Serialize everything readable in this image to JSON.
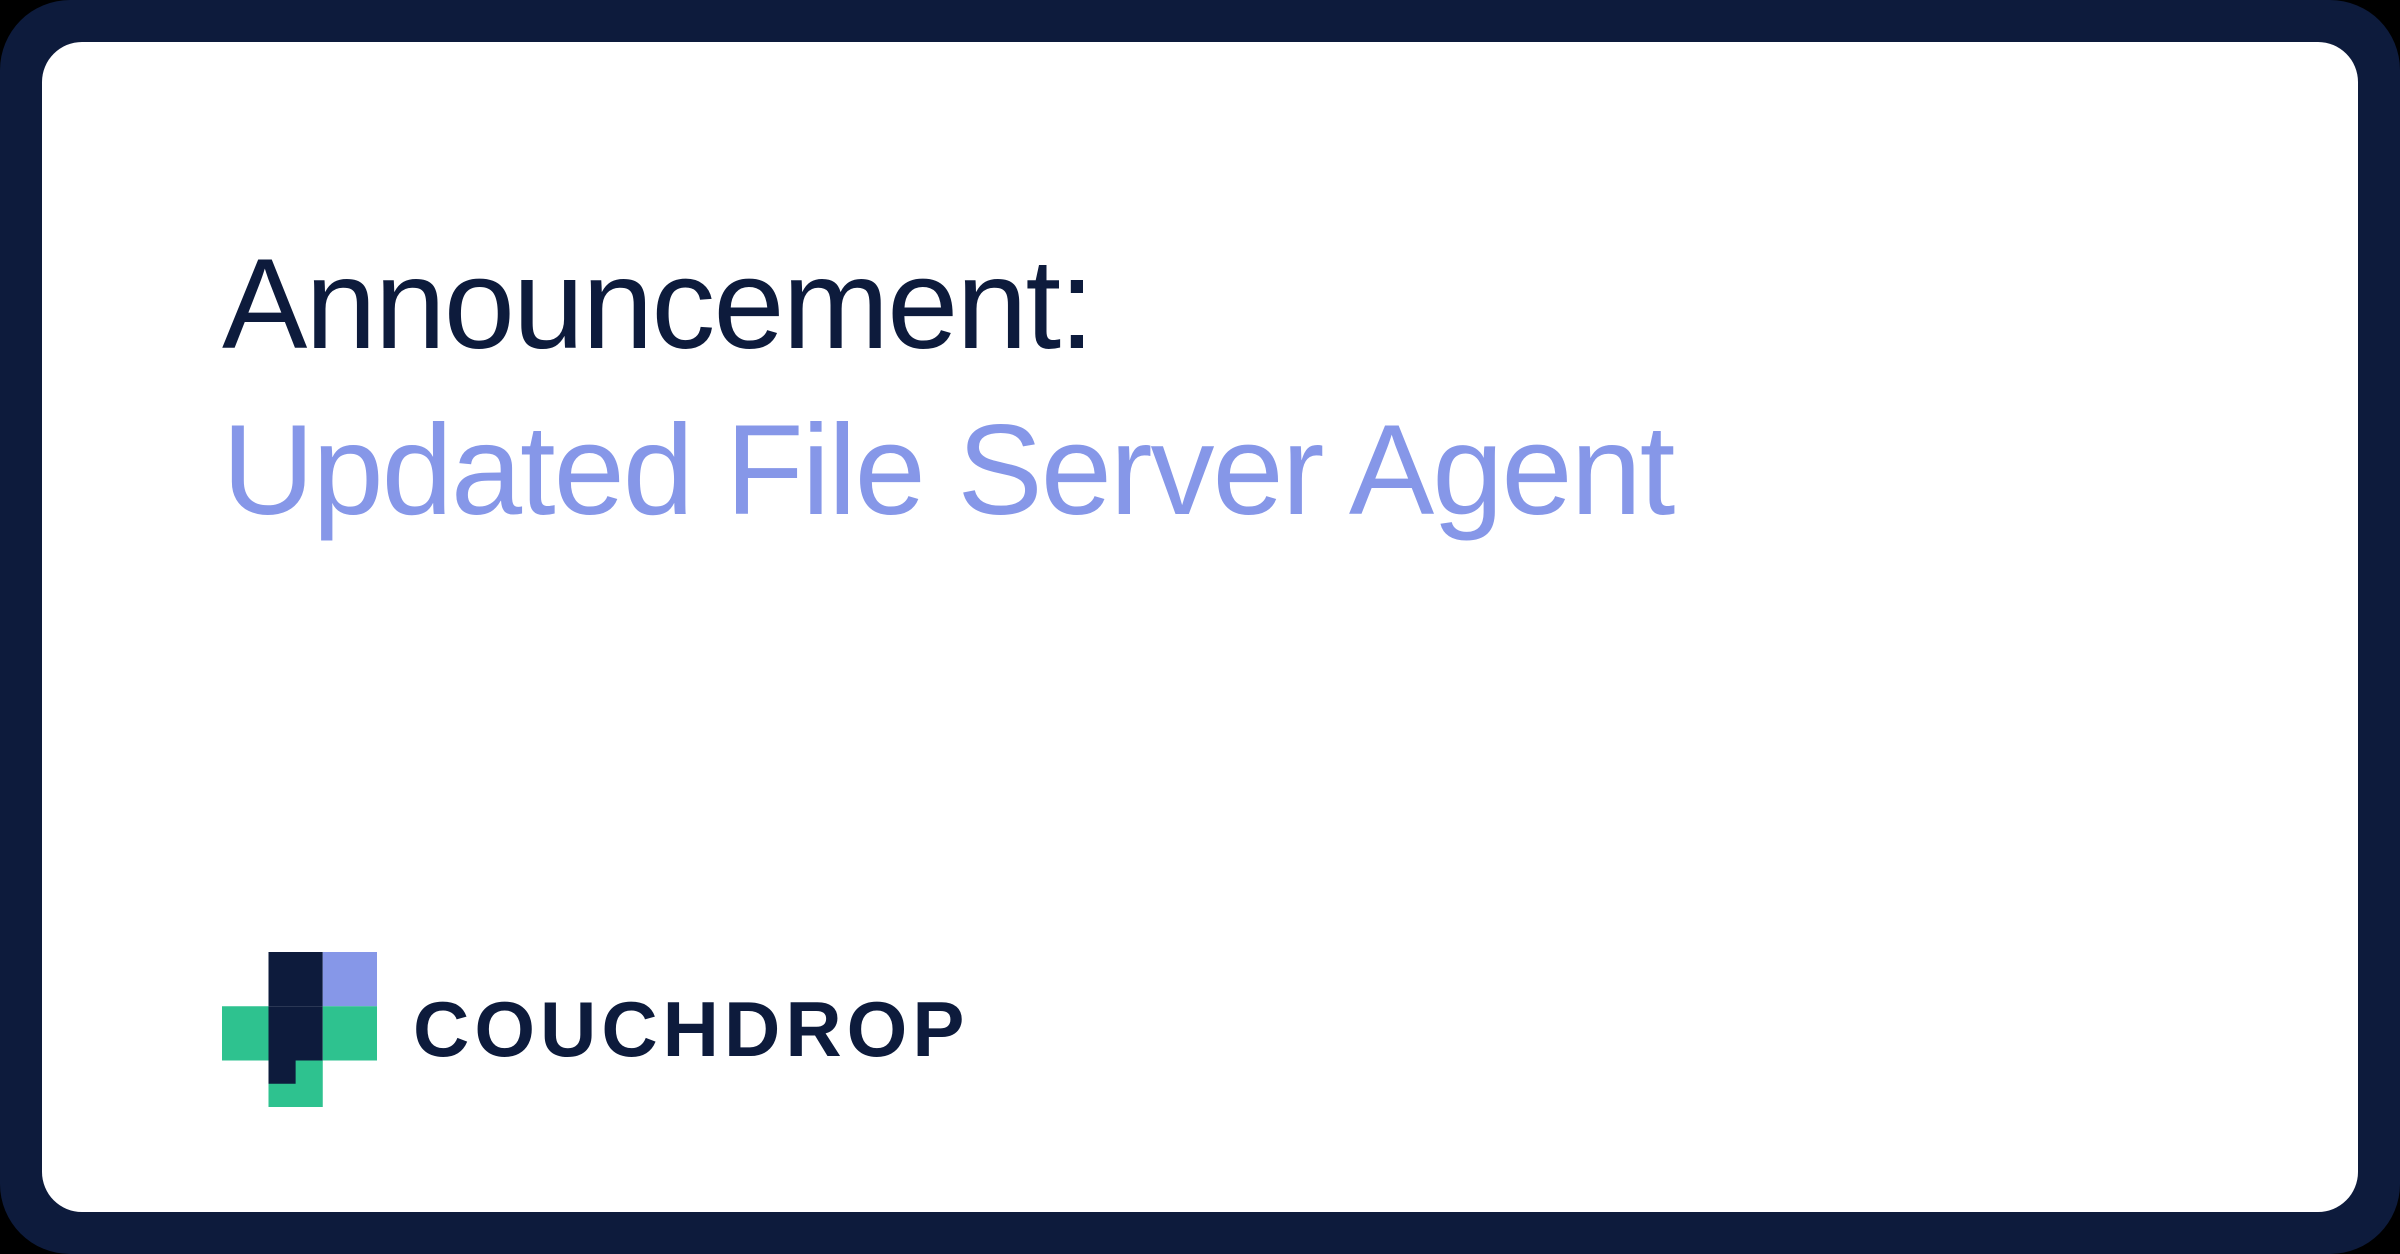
{
  "heading": {
    "line1": "Announcement:",
    "line2": "Updated File Server Agent"
  },
  "brand": {
    "name": "COUCHDROP",
    "colors": {
      "navy": "#0d1b3c",
      "periwinkle": "#8697e8",
      "teal": "#2ec28f"
    }
  }
}
